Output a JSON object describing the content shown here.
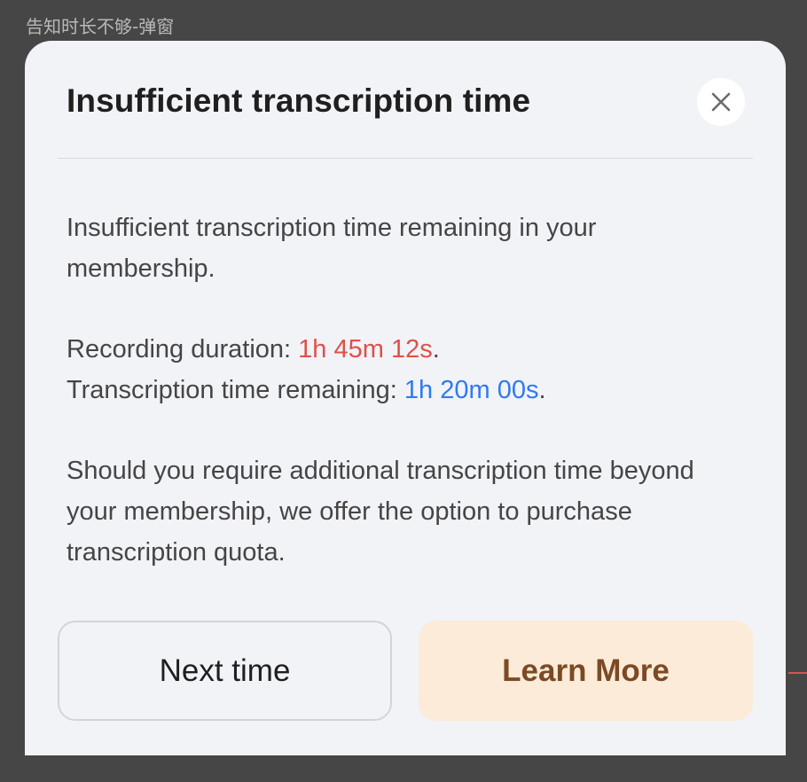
{
  "frame": {
    "label": "告知时长不够-弹窗"
  },
  "dialog": {
    "title": "Insufficient transcription time",
    "close_icon": "close-icon",
    "message_1": "Insufficient transcription time remaining in your membership.",
    "recording_label": "Recording duration: ",
    "recording_value": "1h 45m 12s",
    "remaining_label": "Transcription time remaining: ",
    "remaining_value": "1h 20m 00s",
    "period": ".",
    "message_3": "Should you require additional transcription time beyond your membership, we offer the option to purchase transcription quota.",
    "secondary_button": "Next time",
    "primary_button": "Learn More"
  },
  "colors": {
    "overlay": "#464646",
    "dialog_background": "#f2f3f7",
    "duration_text": "#e0504a",
    "remaining_text": "#2f7af0",
    "primary_button_background": "#fbebd8",
    "primary_button_text": "#7b4a24"
  }
}
